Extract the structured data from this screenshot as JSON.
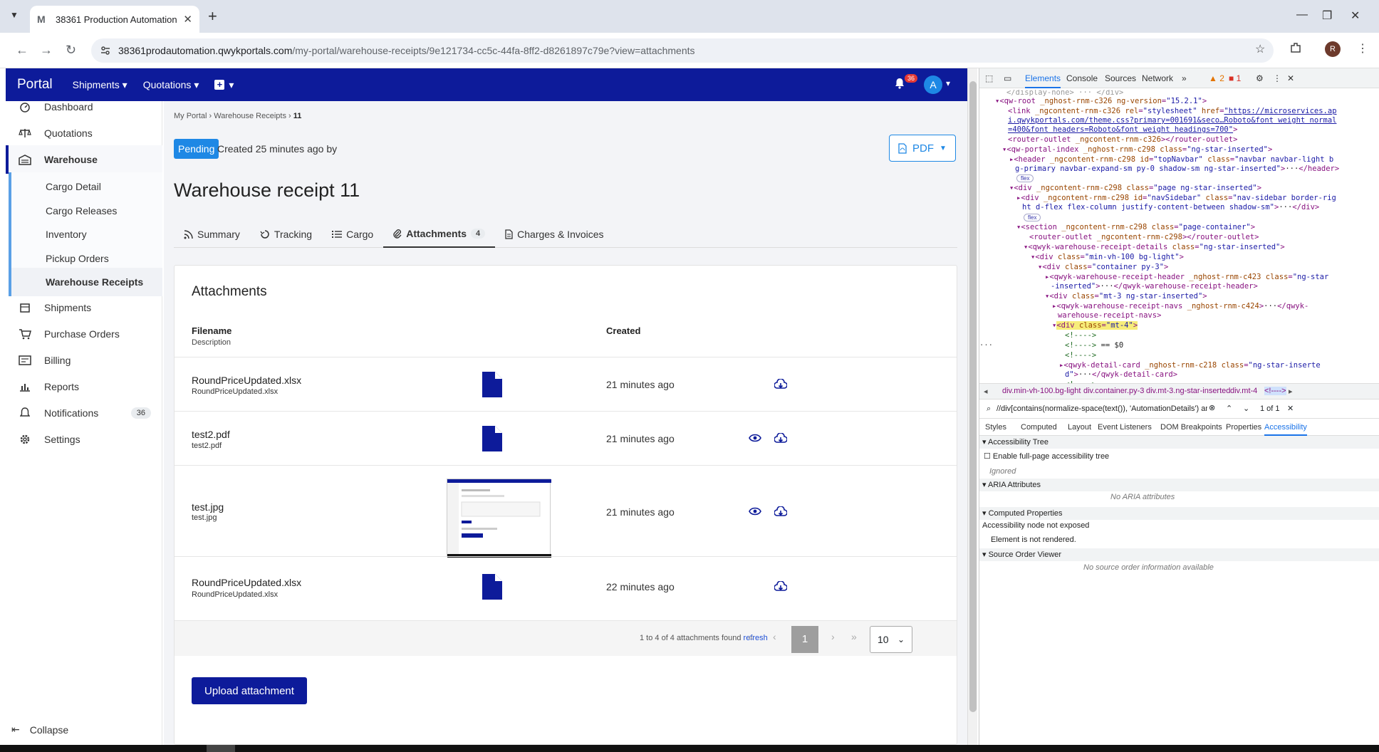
{
  "browser": {
    "tab_title": "38361 Production Automation",
    "url_host": "38361prodautomation.qwykportals.com",
    "url_path": "/my-portal/warehouse-receipts/9e121734-cc5c-44fa-8ff2-d8261897c79e?view=attachments",
    "profile_initial": "R"
  },
  "topnav": {
    "brand": "Portal",
    "items": [
      "Shipments",
      "Quotations"
    ],
    "notifications_count": "36",
    "avatar_initial": "A"
  },
  "sidebar": {
    "items": [
      "Dashboard",
      "Quotations",
      "Warehouse"
    ],
    "warehouse_sub": [
      "Cargo Detail",
      "Cargo Releases",
      "Inventory",
      "Pickup Orders",
      "Warehouse Receipts"
    ],
    "items_after": [
      "Shipments",
      "Purchase Orders",
      "Billing",
      "Reports",
      "Notifications",
      "Settings"
    ],
    "notifications_count": "36",
    "collapse": "Collapse"
  },
  "page": {
    "breadcrumb_root": "My Portal",
    "breadcrumb_mid": "Warehouse Receipts",
    "breadcrumb_current": "11",
    "status": "Pending",
    "created_text": "Created 25 minutes ago by",
    "pdf_label": "PDF",
    "title": "Warehouse receipt 11",
    "tabs": [
      "Summary",
      "Tracking",
      "Cargo",
      "Attachments",
      "Charges & Invoices"
    ],
    "attachments_count": "4"
  },
  "attachments": {
    "heading": "Attachments",
    "col_filename": "Filename",
    "col_description": "Description",
    "col_created": "Created",
    "rows": [
      {
        "name": "RoundPriceUpdated.xlsx",
        "desc": "RoundPriceUpdated.xlsx",
        "created": "21 minutes ago"
      },
      {
        "name": "test2.pdf",
        "desc": "test2.pdf",
        "created": "21 minutes ago"
      },
      {
        "name": "test.jpg",
        "desc": "test.jpg",
        "created": "21 minutes ago"
      },
      {
        "name": "RoundPriceUpdated.xlsx",
        "desc": "RoundPriceUpdated.xlsx",
        "created": "22 minutes ago"
      }
    ],
    "pager_text": "1 to 4 of 4 attachments found",
    "refresh": "refresh",
    "current_page": "1",
    "page_size": "10",
    "upload_label": "Upload attachment"
  },
  "devtools": {
    "tabs": [
      "Elements",
      "Console",
      "Sources",
      "Network"
    ],
    "warnings": "2",
    "errors": "1",
    "crumbs": [
      "div.min-vh-100.bg-light",
      "div.container.py-3",
      "div.mt-3.ng-star-inserted",
      "div.mt-4",
      "<!---->"
    ],
    "search_query": "//div[contains(normalize-space(text()), 'AutomationDetails') and cont",
    "search_result": "1 of 1",
    "sub_tabs": [
      "Styles",
      "Computed",
      "Layout",
      "Event Listeners",
      "DOM Breakpoints",
      "Properties",
      "Accessibility"
    ],
    "acc_tree": "Accessibility Tree",
    "enable_full": "Enable full-page accessibility tree",
    "ignored": "Ignored",
    "aria_attrs": "ARIA Attributes",
    "no_aria": "No ARIA attributes",
    "computed_props": "Computed Properties",
    "not_exposed": "Accessibility node not exposed",
    "not_rendered": "Element is not rendered.",
    "source_order": "Source Order Viewer",
    "no_source": "No source order information available"
  }
}
